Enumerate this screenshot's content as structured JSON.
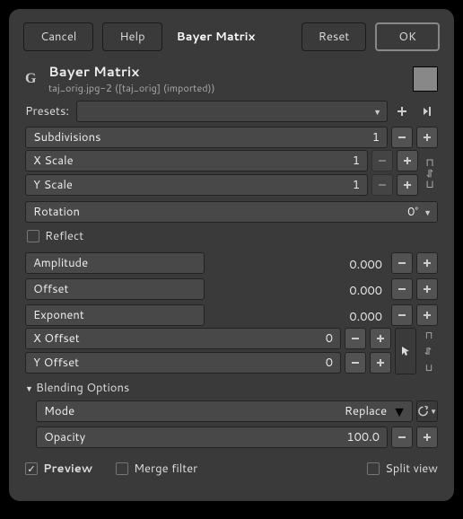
{
  "topbar": {
    "cancel": "Cancel",
    "help": "Help",
    "title": "Bayer Matrix",
    "reset": "Reset",
    "ok": "OK"
  },
  "header": {
    "title": "Bayer Matrix",
    "subtitle": "taj_orig.jpg-2 ([taj_orig] (imported))"
  },
  "presets": {
    "label": "Presets:"
  },
  "params": {
    "subdivisions": {
      "label": "Subdivisions",
      "value": "1"
    },
    "xscale": {
      "label": "X Scale",
      "value": "1"
    },
    "yscale": {
      "label": "Y Scale",
      "value": "1"
    },
    "rotation": {
      "label": "Rotation",
      "value": "0°"
    },
    "reflect": {
      "label": "Reflect"
    },
    "amplitude": {
      "label": "Amplitude",
      "value": "0.000"
    },
    "offset": {
      "label": "Offset",
      "value": "0.000"
    },
    "exponent": {
      "label": "Exponent",
      "value": "0.000"
    },
    "xoffset": {
      "label": "X Offset",
      "value": "0"
    },
    "yoffset": {
      "label": "Y Offset",
      "value": "0"
    }
  },
  "blending": {
    "section": "Blending Options",
    "mode_label": "Mode",
    "mode_value": "Replace",
    "opacity_label": "Opacity",
    "opacity_value": "100.0"
  },
  "footer": {
    "preview": "Preview",
    "merge": "Merge filter",
    "split": "Split view"
  }
}
